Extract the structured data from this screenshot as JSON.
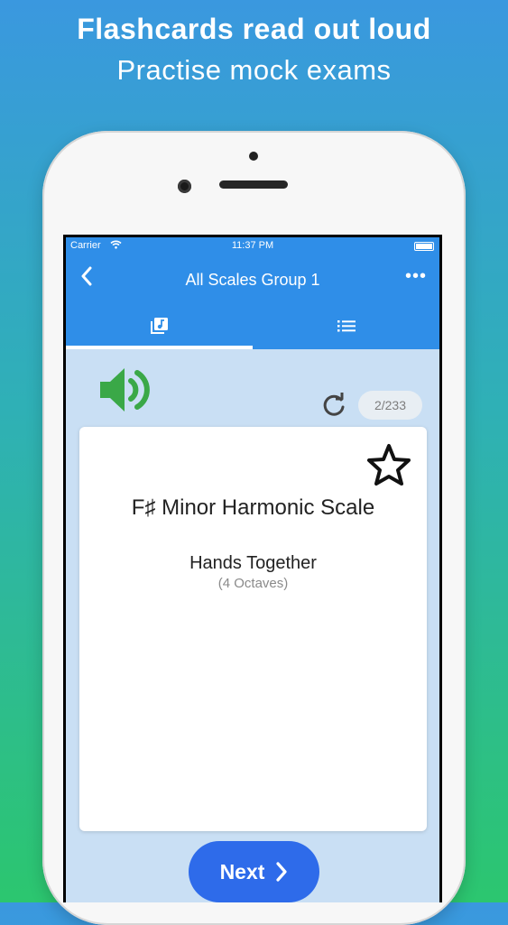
{
  "promo": {
    "title": "Flashcards read out loud",
    "subtitle": "Practise mock exams"
  },
  "status_bar": {
    "carrier": "Carrier",
    "time": "11:37 PM"
  },
  "nav": {
    "title": "All Scales Group 1",
    "more": "•••"
  },
  "tabs": [
    {
      "icon": "music-cards-icon",
      "active": true
    },
    {
      "icon": "list-icon",
      "active": false
    }
  ],
  "card": {
    "counter": "2/233",
    "title": "F♯ Minor Harmonic Scale",
    "subtitle": "Hands Together",
    "detail": "(4 Octaves)"
  },
  "next_button": {
    "label": "Next"
  },
  "colors": {
    "accent": "#2f8ee8",
    "button": "#2e6bea",
    "speaker": "#3aa847",
    "background_top": "#3a98df",
    "background_bottom": "#2cc66f"
  }
}
